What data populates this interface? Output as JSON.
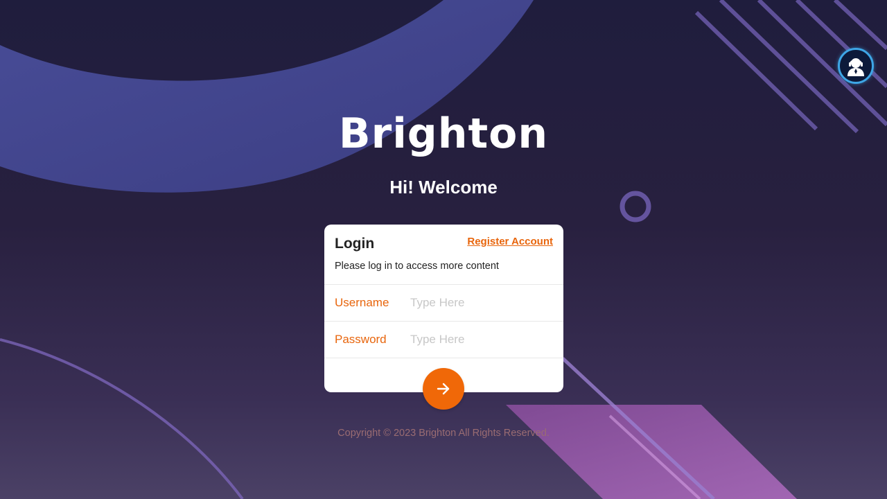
{
  "brand": {
    "name": "Brighton"
  },
  "header": {
    "welcome": "Hi! Welcome"
  },
  "login_card": {
    "title": "Login",
    "register_label": "Register Account",
    "subtitle": "Please log in to access more content",
    "fields": {
      "username": {
        "label": "Username",
        "placeholder": "Type Here",
        "value": ""
      },
      "password": {
        "label": "Password",
        "placeholder": "Type Here",
        "value": ""
      }
    },
    "submit_icon": "arrow-right-icon"
  },
  "support": {
    "icon": "customer-service-headset-icon"
  },
  "footer": {
    "copyright": "Copyright © 2023 Brighton All Rights Reserved."
  },
  "colors": {
    "accent": "#f06808",
    "link": "#e8650c",
    "background_top": "#1f1d3d",
    "background_bottom": "#4b4166",
    "support_ring": "#3ea6e6"
  }
}
